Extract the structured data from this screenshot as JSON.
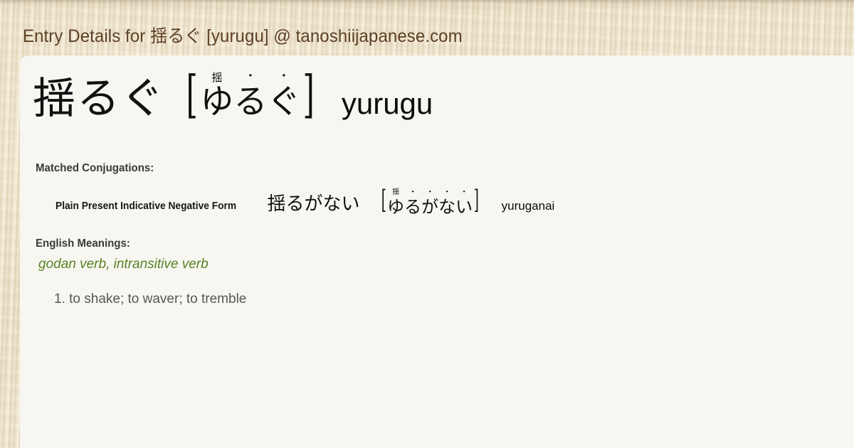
{
  "header": {
    "title": "Entry Details for 揺るぐ [yurugu] @ tanoshiijapanese.com",
    "title_color": "#5c3f26",
    "background_color": "#ded2b4"
  },
  "card": {
    "background_color": "#f7f6f1"
  },
  "entry": {
    "kanji": "揺るぐ",
    "bracket_open": "[",
    "bracket_close": "]",
    "reading_units": [
      {
        "base": "ゆ",
        "ruby": "揺",
        "ruby_type": "kanji"
      },
      {
        "base": "る",
        "ruby": "・",
        "ruby_type": "dot"
      },
      {
        "base": "ぐ",
        "ruby": "・",
        "ruby_type": "dot"
      }
    ],
    "romaji": "yurugu"
  },
  "conjugations": {
    "heading": "Matched Conjugations:",
    "rows": [
      {
        "name": "Plain Present Indicative Negative Form",
        "kanji": "揺るがない",
        "bracket_open": "[",
        "bracket_close": "]",
        "reading_units": [
          {
            "base": "ゆ",
            "ruby": "揺",
            "ruby_type": "kanji"
          },
          {
            "base": "る",
            "ruby": "・",
            "ruby_type": "dot"
          },
          {
            "base": "が",
            "ruby": "・",
            "ruby_type": "dot"
          },
          {
            "base": "な",
            "ruby": "・",
            "ruby_type": "dot"
          },
          {
            "base": "い",
            "ruby": "・",
            "ruby_type": "dot"
          }
        ],
        "romaji": "yuruganai"
      }
    ]
  },
  "meanings": {
    "heading": "English Meanings:",
    "part_of_speech": "godan verb, intransitive verb",
    "part_of_speech_color": "#5b8023",
    "definitions": [
      "1. to shake; to waver; to tremble"
    ]
  }
}
